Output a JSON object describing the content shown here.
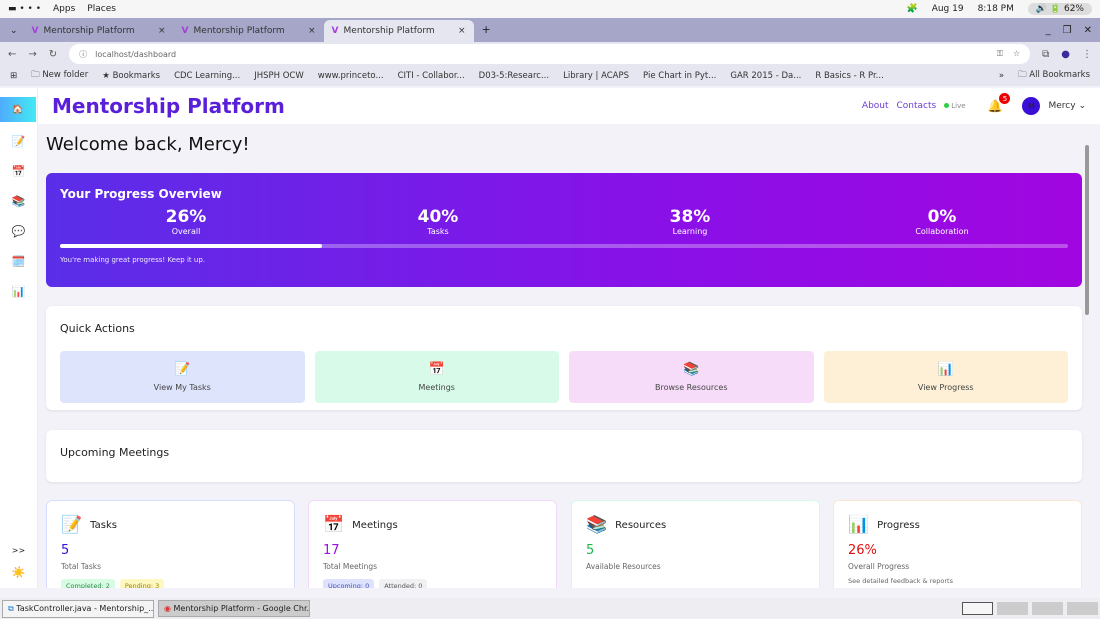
{
  "os": {
    "apps": "Apps",
    "places": "Places",
    "date": "Aug 19",
    "time": "8:18 PM",
    "battery": "62%"
  },
  "browser": {
    "tabs": [
      {
        "title": "Mentorship Platform"
      },
      {
        "title": "Mentorship Platform"
      },
      {
        "title": "Mentorship Platform"
      }
    ],
    "url": "localhost/dashboard",
    "bookmarks": [
      "New folder",
      "Bookmarks",
      "CDC Learning...",
      "JHSPH OCW",
      "www.princeto...",
      "CITI - Collabor...",
      "D03-5:Researc...",
      "Library | ACAPS",
      "Pie Chart in Pyt...",
      "GAR 2015 - Da...",
      "R Basics - R Pr..."
    ],
    "all_bookmarks": "All Bookmarks"
  },
  "sidebar": {
    "icons": [
      "🏠",
      "📝",
      "📅",
      "📚",
      "💬",
      "🗓️",
      "📊"
    ],
    "expand": ">>",
    "theme": "☀️"
  },
  "header": {
    "brand": "Mentorship Platform",
    "about": "About",
    "contacts": "Contacts",
    "live": "Live",
    "notifications": "5",
    "avatar": "M",
    "user": "Mercy"
  },
  "welcome": "Welcome back, Mercy!",
  "progress": {
    "title": "Your Progress Overview",
    "stats": [
      {
        "value": "26%",
        "label": "Overall"
      },
      {
        "value": "40%",
        "label": "Tasks"
      },
      {
        "value": "38%",
        "label": "Learning"
      },
      {
        "value": "0%",
        "label": "Collaboration"
      }
    ],
    "overall_fraction": 0.26,
    "message": "You're making great progress! Keep it up."
  },
  "quick_actions": {
    "title": "Quick Actions",
    "items": [
      {
        "icon": "📝",
        "label": "View My Tasks"
      },
      {
        "icon": "📅",
        "label": "Meetings"
      },
      {
        "icon": "📚",
        "label": "Browse Resources"
      },
      {
        "icon": "📊",
        "label": "View Progress"
      }
    ]
  },
  "upcoming": {
    "title": "Upcoming Meetings"
  },
  "stats": [
    {
      "icon": "📝",
      "title": "Tasks",
      "value": "5",
      "label": "Total Tasks",
      "tags": [
        "Completed: 2",
        "Pending: 3"
      ]
    },
    {
      "icon": "📅",
      "title": "Meetings",
      "value": "17",
      "label": "Total Meetings",
      "tags": [
        "Upcoming: 0",
        "Attended: 0"
      ]
    },
    {
      "icon": "📚",
      "title": "Resources",
      "value": "5",
      "label": "Available Resources"
    },
    {
      "icon": "📊",
      "title": "Progress",
      "value": "26%",
      "label": "Overall Progress",
      "note": "See detailed feedback & reports"
    }
  ],
  "taskbar": [
    "TaskController.java - Mentorship_...",
    "Mentorship Platform - Google Chr..."
  ]
}
